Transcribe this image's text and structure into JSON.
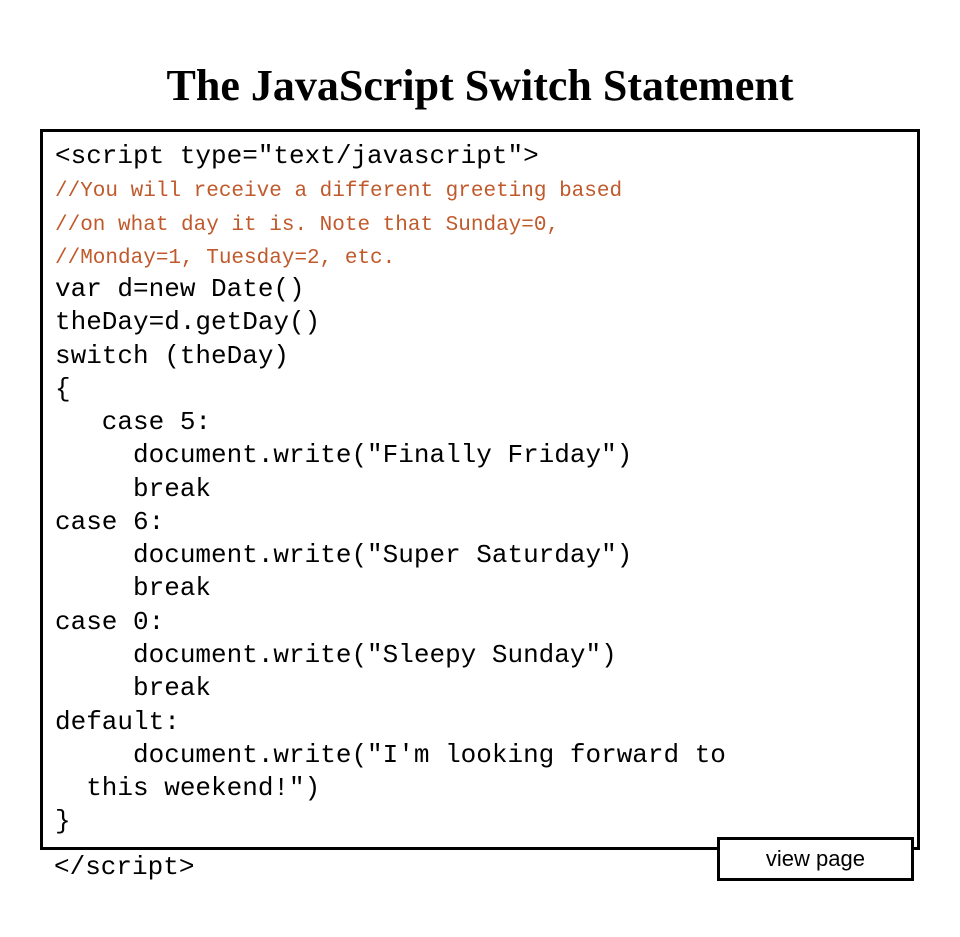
{
  "title": "The JavaScript Switch Statement",
  "code": {
    "open_tag": "<script type=\"text/javascript\">",
    "comment_line1": "//You will receive a different greeting based",
    "comment_line2": "//on what day it is. Note that Sunday=0,",
    "comment_line3": "//Monday=1, Tuesday=2, etc.",
    "line1": "var d=new Date()",
    "line2": "theDay=d.getDay()",
    "line3": "switch (theDay)",
    "line4": "{",
    "line5": "   case 5:",
    "line6": "     document.write(\"Finally Friday\")",
    "line7": "     break",
    "line8": "case 6:",
    "line9": "     document.write(\"Super Saturday\")",
    "line10": "     break",
    "line11": "case 0:",
    "line12": "     document.write(\"Sleepy Sunday\")",
    "line13": "     break",
    "line14": "default:",
    "line15": "     document.write(\"I'm looking forward to",
    "line16": "  this weekend!\")",
    "line17": "}",
    "close_tag": "</script>"
  },
  "button": "view page"
}
